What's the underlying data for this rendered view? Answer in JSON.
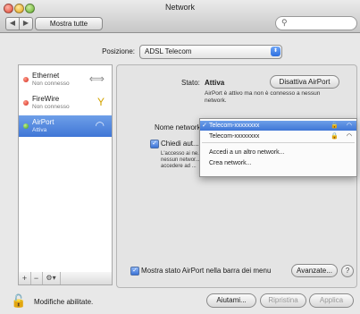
{
  "window": {
    "title": "Network"
  },
  "toolbar": {
    "back_glyph": "◀",
    "forward_glyph": "▶",
    "show_all_label": "Mostra tutte",
    "search_icon": "search-icon"
  },
  "location": {
    "label": "Posizione:",
    "value": "ADSL Telecom"
  },
  "services": [
    {
      "name": "Ethernet",
      "status": "Non connesso",
      "status_color": "#d1261a",
      "icon": "ethernet-arrows-icon",
      "selected": false
    },
    {
      "name": "FireWire",
      "status": "Non connesso",
      "status_color": "#d1261a",
      "icon": "firewire-icon",
      "selected": false
    },
    {
      "name": "AirPort",
      "status": "Attiva",
      "status_color": "#3a9c16",
      "icon": "wifi-icon",
      "selected": true
    }
  ],
  "sidebar_tools": {
    "add": "+",
    "remove": "−",
    "action": "⚙▾"
  },
  "detail": {
    "stato_label": "Stato:",
    "stato_value": "Attiva",
    "disattiva_label": "Disattiva AirPort",
    "stato_desc": "AirPort è attivo ma non è connesso a nessun network.",
    "nome_label": "Nome network",
    "chiedi_label": "Chiedi aut...",
    "chiedi_desc": "L'accesso ai ne... nessun networ... di accedere ad ...",
    "mostra_label": "Mostra stato AirPort nella barra dei menu",
    "avanzate_label": "Avanzate...",
    "help_label": "?"
  },
  "network_menu": {
    "items": [
      {
        "label": "Telecom-xxxxxxxx",
        "checked": true,
        "selected": true
      },
      {
        "label": "Telecom-xxxxxxxx",
        "checked": false,
        "selected": false
      }
    ],
    "other_label": "Accedi a un altro network...",
    "create_label": "Crea network..."
  },
  "footer": {
    "lock_label": "Modifiche abilitate.",
    "aiuto_label": "Aiutami...",
    "ripristina_label": "Ripristina",
    "applica_label": "Applica"
  }
}
